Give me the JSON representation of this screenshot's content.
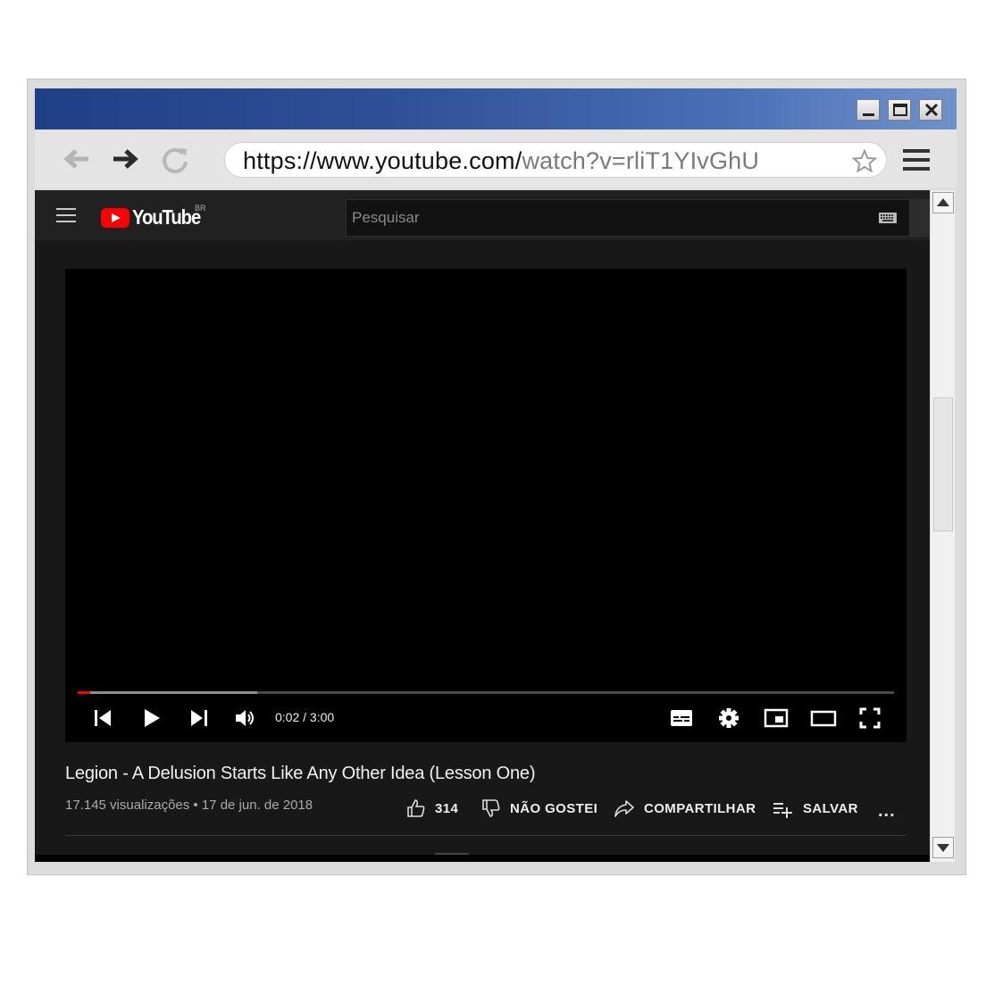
{
  "browser": {
    "url_host": "https://www.youtube.com/",
    "url_path": "watch?v=rliT1YIvGhU"
  },
  "header": {
    "logo_text": "YouTube",
    "region": "BR",
    "search_placeholder": "Pesquisar"
  },
  "player": {
    "time": "0:02 / 3:00",
    "played_fraction": 0.011,
    "buffered_fraction": 0.22,
    "accent_color": "#ff0000"
  },
  "video": {
    "title": "Legion - A Delusion Starts Like Any Other Idea (Lesson One)",
    "meta": "17.145 visualizações • 17 de jun. de 2018",
    "likes": "314",
    "dislike_label": "NÃO GOSTEI",
    "share_label": "COMPARTILHAR",
    "save_label": "SALVAR",
    "more_label": "..."
  },
  "icons": {
    "window": [
      "minimize-icon",
      "maximize-icon",
      "close-icon"
    ],
    "toolbar": [
      "back-arrow-icon",
      "forward-arrow-icon",
      "reload-icon",
      "star-icon",
      "menu-icon"
    ],
    "player": [
      "previous-icon",
      "play-icon",
      "next-icon",
      "volume-icon",
      "subtitles-icon",
      "settings-gear-icon",
      "miniplayer-icon",
      "theater-mode-icon",
      "fullscreen-icon"
    ],
    "actions": [
      "thumbs-up-icon",
      "thumbs-down-icon",
      "share-arrow-icon",
      "add-to-playlist-icon"
    ]
  }
}
